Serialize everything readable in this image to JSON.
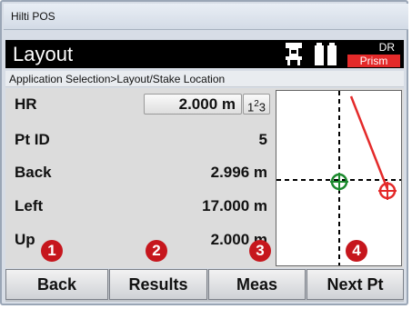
{
  "window": {
    "title": "Hilti POS"
  },
  "header": {
    "title": "Layout",
    "mode_top": "DR",
    "mode_bottom": "Prism"
  },
  "breadcrumb": "Application Selection>Layout/Stake Location",
  "fields": {
    "hr": {
      "label": "HR",
      "value": "2.000 m",
      "numeric_button": "123"
    },
    "pt_id": {
      "label": "Pt ID",
      "value": "5"
    },
    "back": {
      "label": "Back",
      "value": "2.996 m"
    },
    "left": {
      "label": "Left",
      "value": "17.000 m"
    },
    "up": {
      "label": "Up",
      "value": "2.000 m"
    }
  },
  "softkeys": [
    {
      "label": "Back",
      "badge": "1"
    },
    {
      "label": "Results",
      "badge": "2"
    },
    {
      "label": "Meas",
      "badge": "3"
    },
    {
      "label": "Next Pt",
      "badge": "4"
    }
  ],
  "colors": {
    "accent_red": "#e42a2a",
    "badge_red": "#c6161d",
    "target_green": "#1c8a2e"
  },
  "icons": {
    "instrument": "total-station-icon",
    "battery": "battery-icon"
  }
}
